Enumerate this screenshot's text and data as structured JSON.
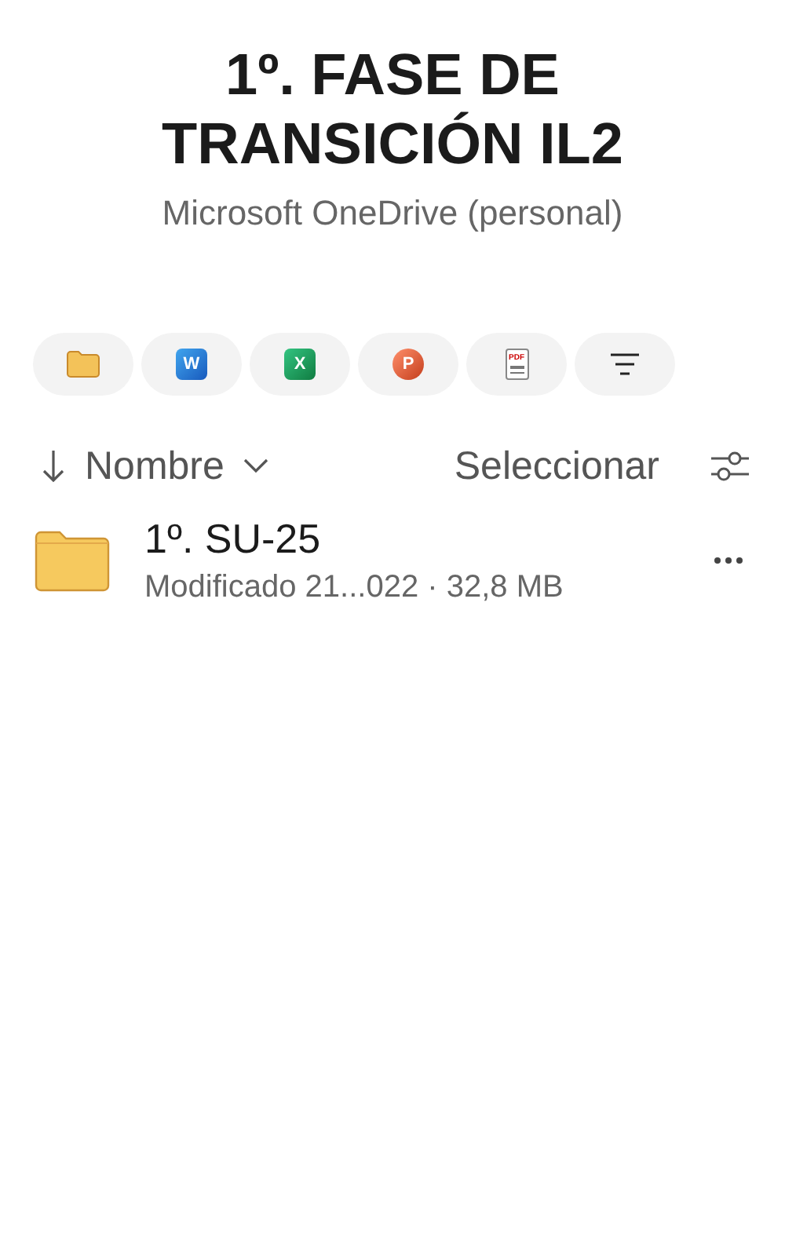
{
  "header": {
    "title": "1º. FASE DE TRANSICIÓN IL2",
    "subtitle": "Microsoft OneDrive (personal)"
  },
  "filter_chips": [
    {
      "kind": "folder"
    },
    {
      "kind": "word",
      "letter": "W"
    },
    {
      "kind": "excel",
      "letter": "X"
    },
    {
      "kind": "powerpoint",
      "letter": "P"
    },
    {
      "kind": "pdf",
      "letter": "PDF"
    },
    {
      "kind": "filter"
    }
  ],
  "sort_bar": {
    "sort_label": "Nombre",
    "select_label": "Seleccionar"
  },
  "items": [
    {
      "kind": "folder",
      "name": "1º. SU-25",
      "details": "Modificado 21...022 · 32,8 MB"
    }
  ]
}
